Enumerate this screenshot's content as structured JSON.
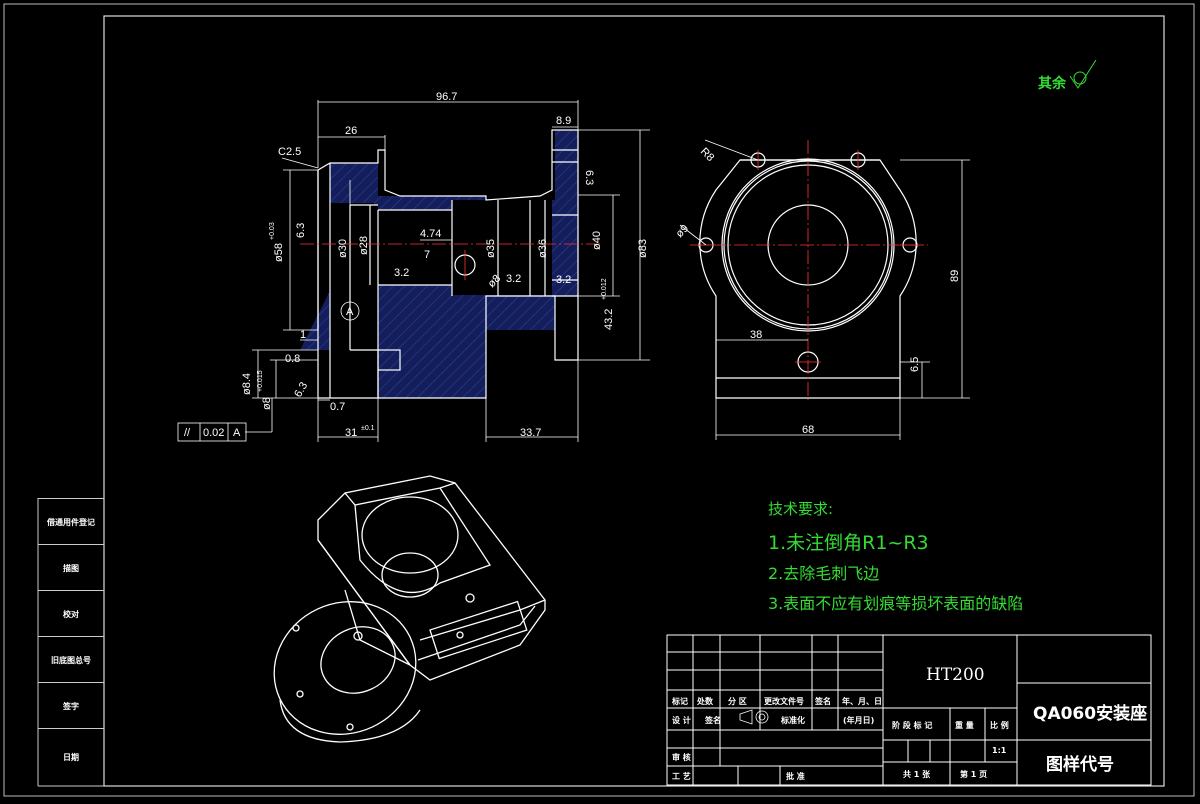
{
  "colors": {
    "background": "#000000",
    "linework": "#ffffff",
    "dimension": "#ffffff",
    "note": "#33dd33",
    "hatch": "#1a2a7a",
    "centerline": "#ff3333"
  },
  "left_strip": [
    "借通用件登记",
    "描图",
    "校对",
    "旧底图总号",
    "签字",
    "日期"
  ],
  "surface_finish_note": "其余",
  "dimensions": {
    "d96_7": "96.7",
    "d26": "26",
    "d8_9": "8.9",
    "dC2_5": "C2.5",
    "d6_3a": "6.3",
    "d63b": "6.3",
    "d58": "ø58",
    "d58tol": "+0.03",
    "d30": "ø30",
    "d28": "ø28",
    "d4_74": "4.74",
    "d7": "7",
    "d8": "ø8",
    "d35": "ø35",
    "d36": "ø36",
    "d40": "ø40",
    "d83": "ø83",
    "d3_2a": "3.2",
    "d3_2b": "3.2",
    "d3_2c": "3.2",
    "d43_2": "43.2",
    "d43tol": "+0.012",
    "dA": "A",
    "d1": "1",
    "d0_8": "0.8",
    "d8_4": "ø8.4",
    "d8h": "ø8",
    "d8htol": "+0.015",
    "d6_3c": "6.3",
    "d0_7": "0.7",
    "d31": "31",
    "d31tol": "±0.1",
    "d33_7": "33.7",
    "tol_sym": "//",
    "tol_val": "0.02",
    "tol_ref": "A",
    "dR8": "R8",
    "dR9": "ø9",
    "d38": "38",
    "d68": "68",
    "d89": "89",
    "d6_5": "6.5"
  },
  "tech_requirements": {
    "heading": "技术要求:",
    "items": [
      "1.未注倒角R1~R3",
      "2.去除毛刺飞边",
      "3.表面不应有划痕等损坏表面的缺陷"
    ]
  },
  "title_block": {
    "material": "HT200",
    "part_name": "QA060安装座",
    "drawing_code": "图样代号",
    "row_labels": [
      "标记",
      "处数",
      "分 区",
      "更改文件号",
      "签名",
      "年、月、日"
    ],
    "row2": [
      "设 计",
      "签名",
      "标准化",
      "(年月日)"
    ],
    "row3": [
      "审 核"
    ],
    "row4": [
      "工 艺",
      "批 准"
    ],
    "stage_labels": [
      "阶 段 标 记",
      "重 量",
      "比 例"
    ],
    "scale": "1:1",
    "sheets_total": "共 1 张",
    "sheet_no": "第 1 页"
  }
}
